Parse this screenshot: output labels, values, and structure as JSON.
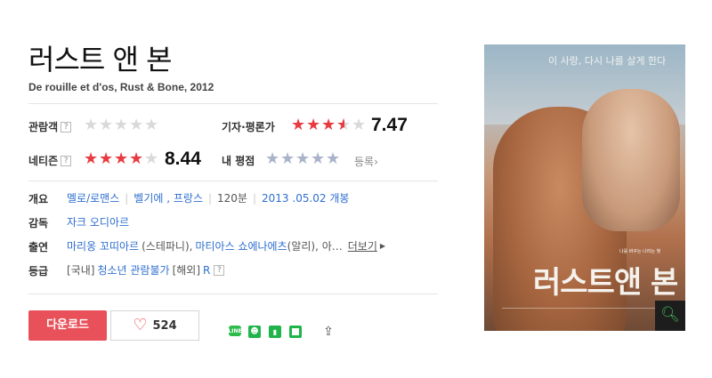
{
  "movie": {
    "title": "러스트 앤 본",
    "subtitle": "De rouille et d'os, Rust & Bone, 2012"
  },
  "ratings": {
    "audience": {
      "label": "관람객",
      "help": "?",
      "stars_filled": 0
    },
    "critic": {
      "label": "기자·평론가",
      "score": "7.47",
      "stars_filled": 3.5
    },
    "netizen": {
      "label": "네티즌",
      "help": "?",
      "score": "8.44",
      "stars_filled": 4
    },
    "my_rating": {
      "label": "내 평점",
      "stars_filled": 0,
      "link": "등록"
    }
  },
  "info": {
    "overview": {
      "label": "개요",
      "genre": "멜로/로맨스",
      "countries": "벨기에 , 프랑스",
      "runtime": "120분",
      "release": "2013 .05.02 개봉"
    },
    "director": {
      "label": "감독",
      "name": "자크 오디아르"
    },
    "cast": {
      "label": "출연",
      "actor1": "마리옹 꼬띠아르",
      "role1": "(스테파니),",
      "actor2": "마티아스 쇼에나에츠",
      "role2": "(알리), 아…",
      "more": "더보기"
    },
    "grade": {
      "label": "등급",
      "korea_prefix": "[국내]",
      "korea": "청소년 관람불가",
      "overseas_prefix": "[해외]",
      "overseas": "R",
      "help": "?"
    }
  },
  "actions": {
    "download": "다운로드",
    "like_count": "524"
  },
  "share": {
    "line_label": "LINE",
    "icons": [
      "line-icon",
      "band-icon",
      "bookmark-icon",
      "blog-icon",
      "share-icon"
    ]
  },
  "poster": {
    "tagline": "이 사랑, 다시 나를 살게 한다",
    "small_tagline": "나를 바꾸는 나라는 빛",
    "title": "러스트앤 본"
  },
  "colors": {
    "red_star": "#e83b41",
    "download_button": "#e8505a",
    "link_blue": "#2f6fcf"
  }
}
